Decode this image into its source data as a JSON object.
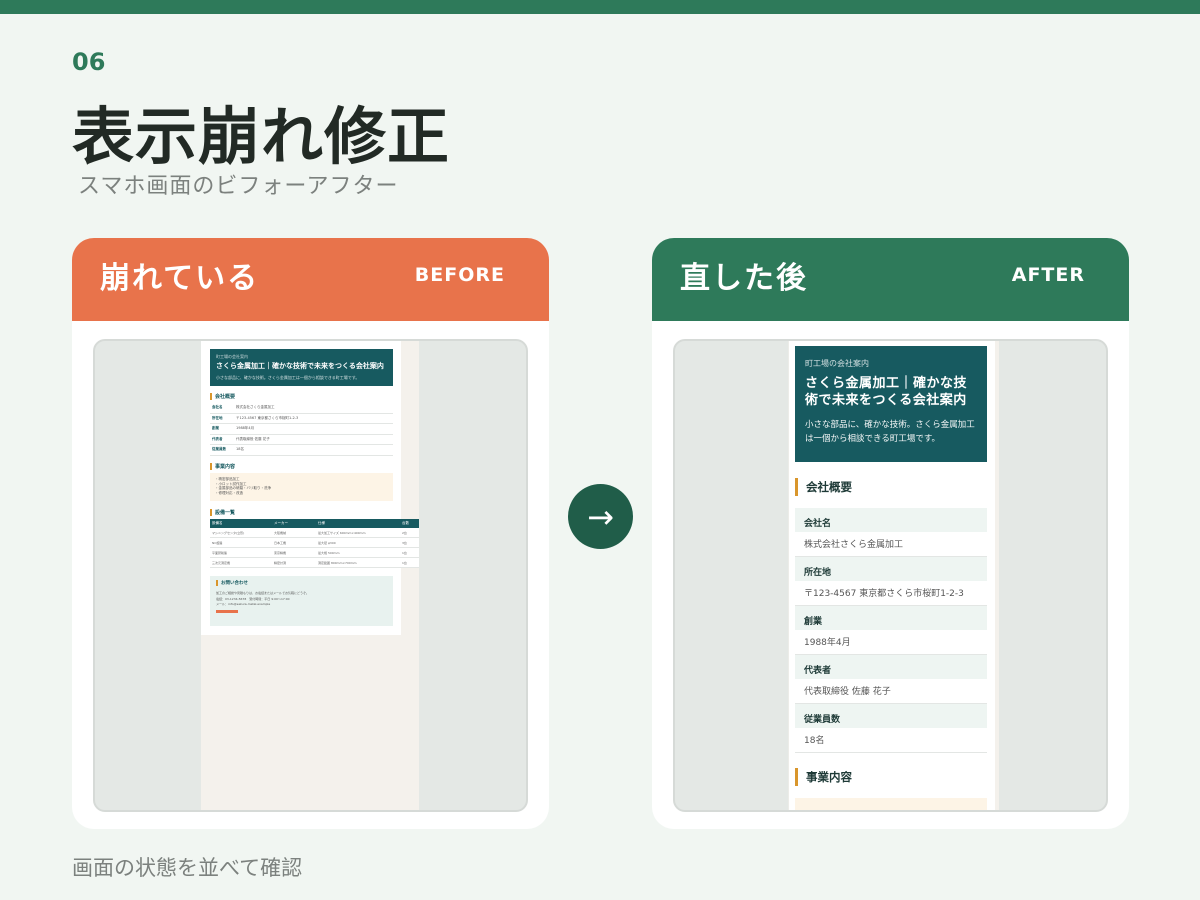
{
  "header": {
    "section_number": "06",
    "title": "表示崩れ修正",
    "subtitle": "スマホ画面のビフォーアフター"
  },
  "before": {
    "title": "崩れている",
    "tag": "BEFORE",
    "screenshot": {
      "eyebrow": "町工場の会社案内",
      "heading": "さくら金属加工｜確かな技術で未来をつくる会社案内",
      "lead": "小さな部品に、確かな技術。さくら金属加工は一個から相談できる町工場です。",
      "overview_heading": "会社概要",
      "overview_rows": [
        {
          "label": "会社名",
          "value": "株式会社さくら金属加工"
        },
        {
          "label": "所在地",
          "value": "〒123-4567 東京都さくら市桜町1-2-3"
        },
        {
          "label": "創業",
          "value": "1988年4月"
        },
        {
          "label": "代表者",
          "value": "代表取締役 佐藤 花子"
        },
        {
          "label": "従業員数",
          "value": "18名"
        }
      ],
      "business_heading": "事業内容",
      "business_items": [
        "・精密部品加工",
        "・小ロット試作加工",
        "・金属部品の研磨・バリ取り・洗浄",
        "・修理対応・改造"
      ],
      "equipment_heading": "設備一覧",
      "equipment_columns": [
        "設備名",
        "メーカー",
        "仕様",
        "台数"
      ],
      "equipment_rows": [
        [
          "マシニングセンタ(立形)",
          "大阪機械",
          "最大加工サイズ 600mm×400mm",
          "2台"
        ],
        [
          "NC旋盤",
          "日本工機",
          "最大径 φ300",
          "3台"
        ],
        [
          "平面研削盤",
          "東京精機",
          "最大幅 500mm",
          "1台"
        ],
        [
          "三次元測定機",
          "精密計測",
          "測定範囲 800mm×700mm",
          "1台"
        ]
      ],
      "contact_heading": "お問い合わせ",
      "contact_lines": [
        "加工のご相談や見積もりは、お電話またはメールでお気軽にどうぞ。",
        "電話：03-1234-5678　受付時間：平日 9:00〜17:00",
        "メール：info@sakura-metal.example"
      ]
    }
  },
  "after": {
    "title": "直した後",
    "tag": "AFTER",
    "screenshot": {
      "eyebrow": "町工場の会社案内",
      "heading": "さくら金属加工｜確かな技術で未来をつくる会社案内",
      "lead": "小さな部品に、確かな技術。さくら金属加工は一個から相談できる町工場です。",
      "overview_heading": "会社概要",
      "overview_rows": [
        {
          "label": "会社名",
          "value": "株式会社さくら金属加工"
        },
        {
          "label": "所在地",
          "value": "〒123-4567 東京都さくら市桜町1-2-3"
        },
        {
          "label": "創業",
          "value": "1988年4月"
        },
        {
          "label": "代表者",
          "value": "代表取締役 佐藤 花子"
        },
        {
          "label": "従業員数",
          "value": "18名"
        }
      ],
      "business_heading": "事業内容"
    }
  },
  "arrow": "→",
  "caption": "画面の状態を並べて確認",
  "colors": {
    "brand_green": "#2e7a5a",
    "before_orange": "#e8734b",
    "hero_teal": "#175a60",
    "accent_gold": "#d9962c"
  }
}
